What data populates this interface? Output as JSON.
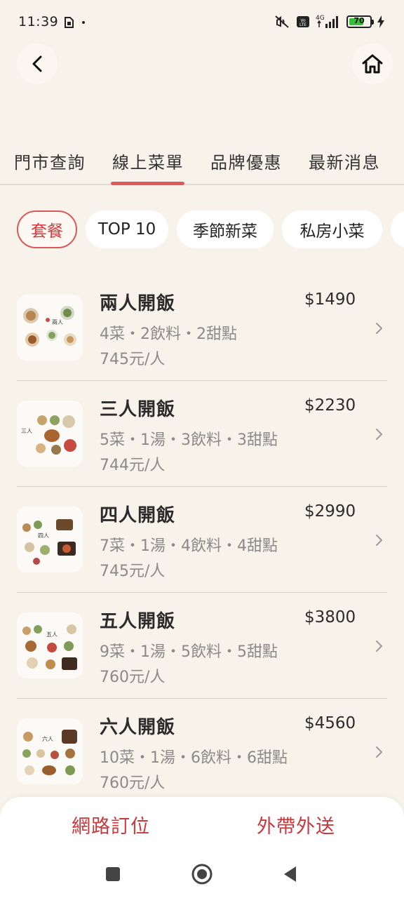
{
  "status_bar": {
    "time": "11:39",
    "network": "4G",
    "battery": "70",
    "battery_level": 0.7,
    "icons": [
      "sim-card-icon",
      "dot-icon",
      "mute-icon",
      "volte-icon",
      "signal-icon",
      "battery-icon",
      "charging-icon"
    ]
  },
  "nav": {
    "back_icon": "chevron-left-icon",
    "home_icon": "home-icon"
  },
  "tabs": [
    {
      "label": "門市查詢",
      "active": false
    },
    {
      "label": "線上菜單",
      "active": true
    },
    {
      "label": "品牌優惠",
      "active": false
    },
    {
      "label": "最新消息",
      "active": false
    }
  ],
  "categories": [
    {
      "label": "套餐",
      "active": true
    },
    {
      "label": "TOP 10",
      "active": false
    },
    {
      "label": "季節新菜",
      "active": false
    },
    {
      "label": "私房小菜",
      "active": false
    }
  ],
  "menu_items": [
    {
      "title": "兩人開飯",
      "desc": "4菜・2飲料・2甜點",
      "per_person": "745元/人",
      "price": "$1490"
    },
    {
      "title": "三人開飯",
      "desc": "5菜・1湯・3飲料・3甜點",
      "per_person": "744元/人",
      "price": "$2230"
    },
    {
      "title": "四人開飯",
      "desc": "7菜・1湯・4飲料・4甜點",
      "per_person": "745元/人",
      "price": "$2990"
    },
    {
      "title": "五人開飯",
      "desc": "9菜・1湯・5飲料・5甜點",
      "per_person": "760元/人",
      "price": "$3800"
    },
    {
      "title": "六人開飯",
      "desc": "10菜・1湯・6飲料・6甜點",
      "per_person": "760元/人",
      "price": "$4560"
    }
  ],
  "actions": {
    "reserve": "網路訂位",
    "takeout": "外帶外送"
  },
  "colors": {
    "background": "#f8f3ea",
    "accent": "#d9585c",
    "action_text": "#c8383d"
  }
}
